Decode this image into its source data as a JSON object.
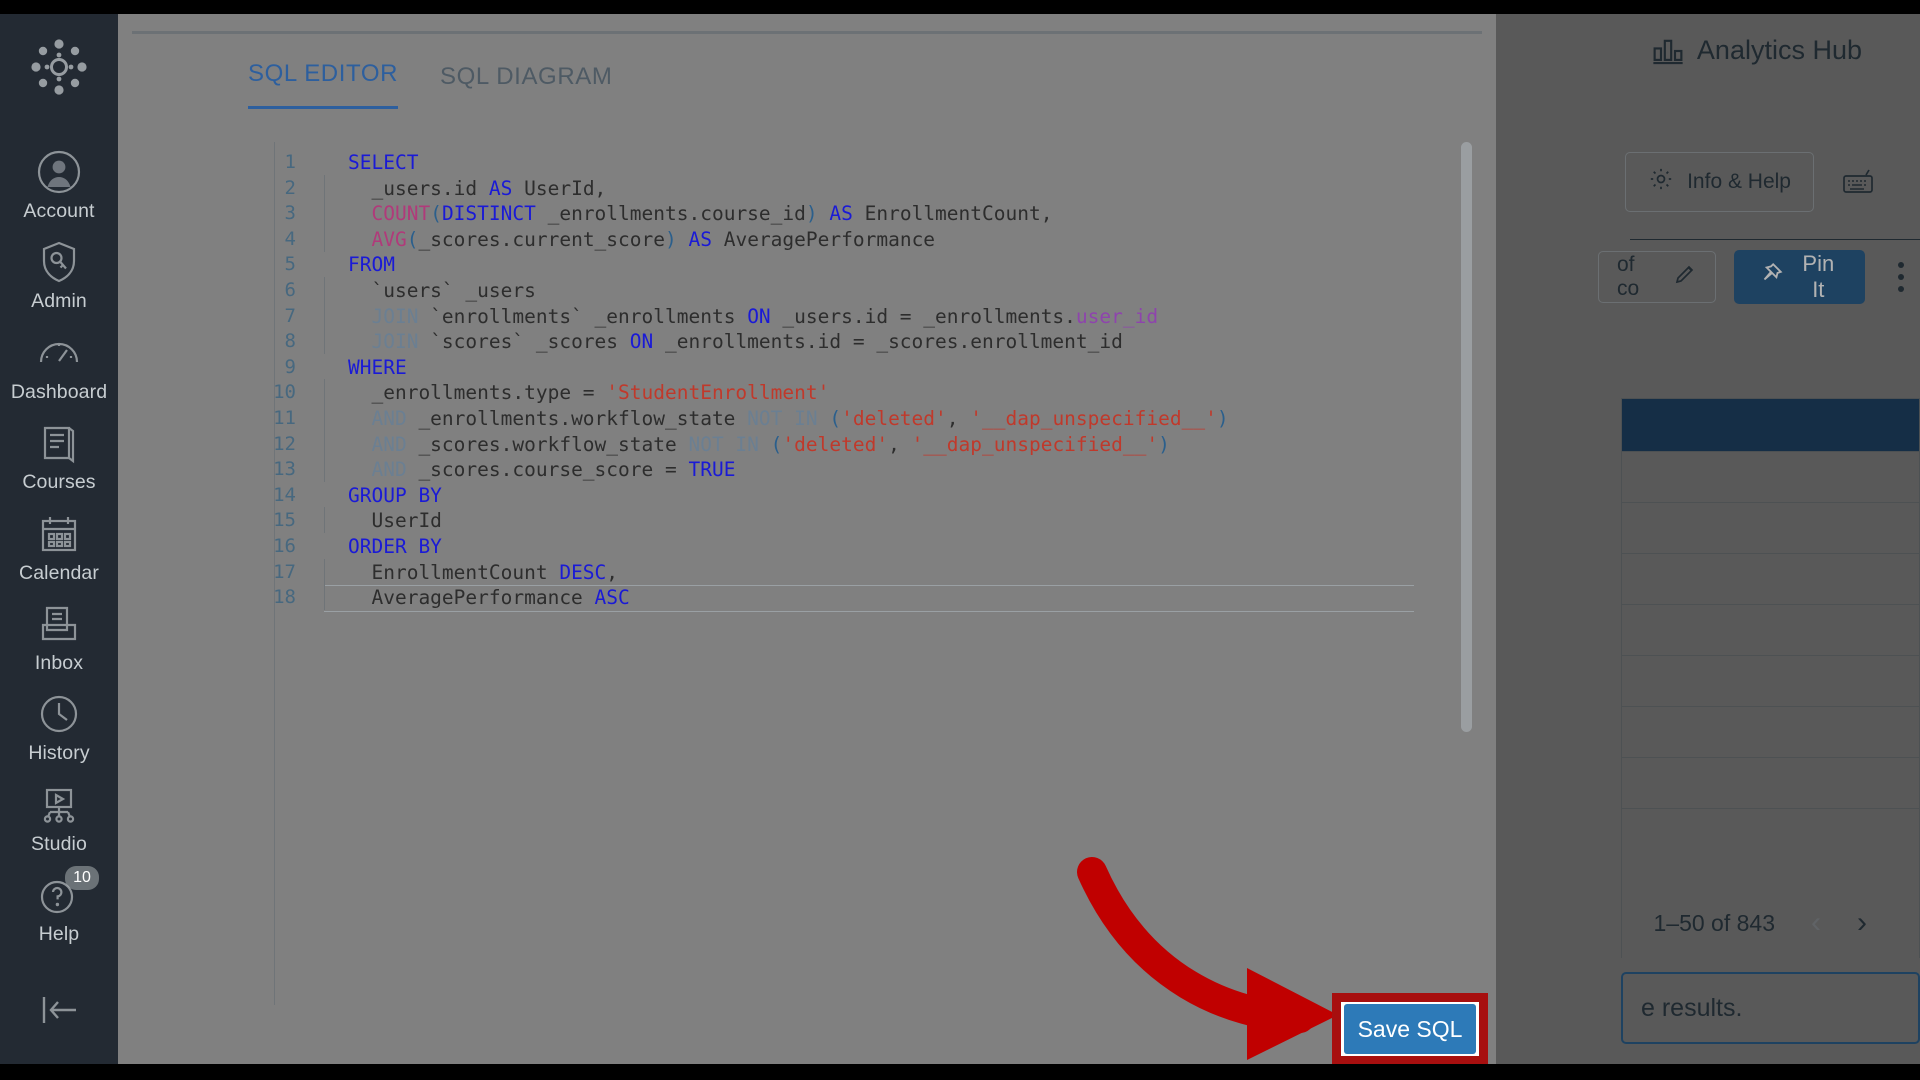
{
  "global_nav": {
    "logo_icon": "canvas-logo-icon",
    "items": [
      {
        "label": "Account",
        "icon": "user-circle-icon"
      },
      {
        "label": "Admin",
        "icon": "shield-key-icon"
      },
      {
        "label": "Dashboard",
        "icon": "gauge-icon"
      },
      {
        "label": "Courses",
        "icon": "book-icon"
      },
      {
        "label": "Calendar",
        "icon": "calendar-icon"
      },
      {
        "label": "Inbox",
        "icon": "inbox-icon"
      },
      {
        "label": "History",
        "icon": "clock-icon"
      },
      {
        "label": "Studio",
        "icon": "studio-screen-icon"
      },
      {
        "label": "Help",
        "icon": "question-circle-icon",
        "badge": "10"
      }
    ],
    "collapse_icon": "collapse-left-icon"
  },
  "background_app": {
    "header_title": "Analytics Hub",
    "header_icon": "bar-chart-icon",
    "info_help_label": "Info & Help",
    "info_help_icon": "gear-icon",
    "keyboard_icon": "keyboard-icon",
    "chip_text": "of co",
    "chip_icon": "pencil-icon",
    "pin_label": "Pin It",
    "pin_icon": "pin-icon",
    "kebab_icon": "more-vertical-icon",
    "pagination_label": "1–50 of 843",
    "prev_icon": "chevron-left-icon",
    "next_icon": "chevron-right-icon",
    "note_text": "e results."
  },
  "modal": {
    "tabs": [
      {
        "label": "SQL EDITOR",
        "active": true
      },
      {
        "label": "SQL DIAGRAM",
        "active": false
      }
    ],
    "save_button_label": "Save SQL"
  },
  "editor": {
    "language": "sql",
    "lines": [
      {
        "n": 1,
        "indent": false,
        "tokens": [
          {
            "t": "SELECT",
            "c": "k"
          }
        ]
      },
      {
        "n": 2,
        "indent": true,
        "tokens": [
          {
            "t": "  _users.id ",
            "c": "id"
          },
          {
            "t": "AS",
            "c": "k"
          },
          {
            "t": " UserId,",
            "c": "id"
          }
        ]
      },
      {
        "n": 3,
        "indent": true,
        "tokens": [
          {
            "t": "  COUNT",
            "c": "fn"
          },
          {
            "t": "(",
            "c": "p"
          },
          {
            "t": "DISTINCT",
            "c": "k"
          },
          {
            "t": " _enrollments.course_id",
            "c": "id"
          },
          {
            "t": ")",
            "c": "p"
          },
          {
            "t": " ",
            "c": "id"
          },
          {
            "t": "AS",
            "c": "k"
          },
          {
            "t": " EnrollmentCount,",
            "c": "id"
          }
        ]
      },
      {
        "n": 4,
        "indent": true,
        "tokens": [
          {
            "t": "  AVG",
            "c": "fn"
          },
          {
            "t": "(",
            "c": "p"
          },
          {
            "t": "_scores.current_score",
            "c": "id"
          },
          {
            "t": ")",
            "c": "p"
          },
          {
            "t": " ",
            "c": "id"
          },
          {
            "t": "AS",
            "c": "k"
          },
          {
            "t": " AveragePerformance",
            "c": "id"
          }
        ]
      },
      {
        "n": 5,
        "indent": false,
        "tokens": [
          {
            "t": "FROM",
            "c": "k"
          }
        ]
      },
      {
        "n": 6,
        "indent": true,
        "tokens": [
          {
            "t": "  `users` _users",
            "c": "id"
          }
        ]
      },
      {
        "n": 7,
        "indent": true,
        "tokens": [
          {
            "t": "  JOIN",
            "c": "k2"
          },
          {
            "t": " `enrollments` _enrollments ",
            "c": "id"
          },
          {
            "t": "ON",
            "c": "k"
          },
          {
            "t": " _users.id = _enrollments.",
            "c": "id"
          },
          {
            "t": "user_id",
            "c": "col"
          }
        ]
      },
      {
        "n": 8,
        "indent": true,
        "tokens": [
          {
            "t": "  JOIN",
            "c": "k2"
          },
          {
            "t": " `scores` _scores ",
            "c": "id"
          },
          {
            "t": "ON",
            "c": "k"
          },
          {
            "t": " _enrollments.id = _scores.enrollment_id",
            "c": "id"
          }
        ]
      },
      {
        "n": 9,
        "indent": false,
        "tokens": [
          {
            "t": "WHERE",
            "c": "k"
          }
        ]
      },
      {
        "n": 10,
        "indent": true,
        "tokens": [
          {
            "t": "  _enrollments.type = ",
            "c": "id"
          },
          {
            "t": "'StudentEnrollment'",
            "c": "s"
          }
        ]
      },
      {
        "n": 11,
        "indent": true,
        "tokens": [
          {
            "t": "  AND",
            "c": "k2"
          },
          {
            "t": " _enrollments.workflow_state ",
            "c": "id"
          },
          {
            "t": "NOT IN",
            "c": "k2"
          },
          {
            "t": " (",
            "c": "p"
          },
          {
            "t": "'deleted'",
            "c": "s"
          },
          {
            "t": ", ",
            "c": "id"
          },
          {
            "t": "'__dap_unspecified__'",
            "c": "s"
          },
          {
            "t": ")",
            "c": "p"
          }
        ]
      },
      {
        "n": 12,
        "indent": true,
        "tokens": [
          {
            "t": "  AND",
            "c": "k2"
          },
          {
            "t": " _scores.workflow_state ",
            "c": "id"
          },
          {
            "t": "NOT IN",
            "c": "k2"
          },
          {
            "t": " (",
            "c": "p"
          },
          {
            "t": "'deleted'",
            "c": "s"
          },
          {
            "t": ", ",
            "c": "id"
          },
          {
            "t": "'__dap_unspecified__'",
            "c": "s"
          },
          {
            "t": ")",
            "c": "p"
          }
        ]
      },
      {
        "n": 13,
        "indent": true,
        "tokens": [
          {
            "t": "  AND",
            "c": "k2"
          },
          {
            "t": " _scores.course_score = ",
            "c": "id"
          },
          {
            "t": "TRUE",
            "c": "k"
          }
        ]
      },
      {
        "n": 14,
        "indent": false,
        "tokens": [
          {
            "t": "GROUP BY",
            "c": "k"
          }
        ]
      },
      {
        "n": 15,
        "indent": true,
        "tokens": [
          {
            "t": "  UserId",
            "c": "id"
          }
        ]
      },
      {
        "n": 16,
        "indent": false,
        "tokens": [
          {
            "t": "ORDER BY",
            "c": "k"
          }
        ]
      },
      {
        "n": 17,
        "indent": true,
        "tokens": [
          {
            "t": "  EnrollmentCount ",
            "c": "id"
          },
          {
            "t": "DESC",
            "c": "k"
          },
          {
            "t": ",",
            "c": "id"
          }
        ]
      },
      {
        "n": 18,
        "indent": true,
        "tokens": [
          {
            "t": "  AveragePerformance ",
            "c": "id"
          },
          {
            "t": "ASC",
            "c": "k"
          }
        ]
      }
    ]
  },
  "colors": {
    "nav_bg": "#232a33",
    "dim_backdrop": "#808080",
    "modal_bg": "#808080",
    "tab_active": "#2d5f9e",
    "keyword": "#1a1ad6",
    "keyword_secondary": "#6b7f92",
    "function": "#b03a7a",
    "string": "#c0392b",
    "annotation_red": "#a70f0f",
    "save_blue": "#2d7ab8",
    "pin_blue": "#2b5f8c",
    "table_header": "#1f4265"
  }
}
